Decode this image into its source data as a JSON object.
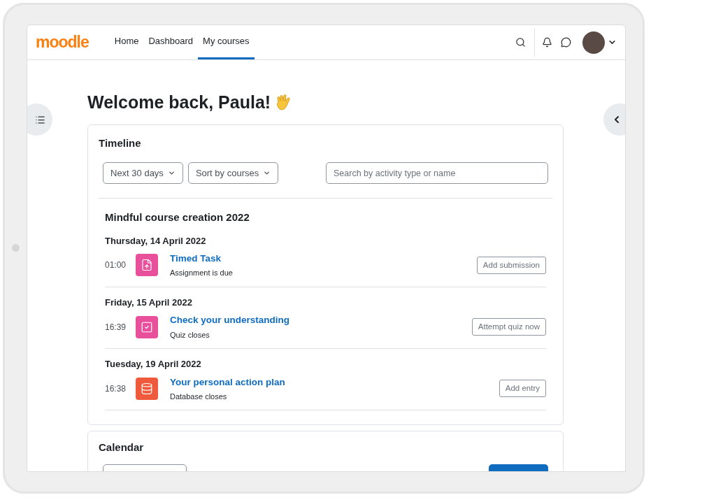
{
  "navbar": {
    "logo": "moodle",
    "links": [
      {
        "label": "Home",
        "selected": false
      },
      {
        "label": "Dashboard",
        "selected": false
      },
      {
        "label": "My courses",
        "selected": true
      }
    ]
  },
  "heading": "Welcome back, Paula!",
  "timeline": {
    "title": "Timeline",
    "filters": [
      "Next 30 days",
      "Sort by courses"
    ],
    "search": {
      "placeholder": "Search by activity type or name"
    },
    "course": "Mindful course creation 2022",
    "days": [
      {
        "date": "Thursday, 14 April 2022",
        "events": [
          {
            "time": "01:00",
            "kind": "assignment",
            "color": "#e8509b",
            "title": "Timed Task",
            "subtitle": "Assignment is due",
            "action": "Add submission"
          }
        ]
      },
      {
        "date": "Friday, 15 April 2022",
        "events": [
          {
            "time": "16:39",
            "kind": "quiz",
            "color": "#e8509b",
            "title": "Check your understanding",
            "subtitle": "Quiz closes",
            "action": "Attempt quiz now"
          }
        ]
      },
      {
        "date": "Tuesday, 19 April 2022",
        "events": [
          {
            "time": "16:38",
            "kind": "database",
            "color": "#f05a3c",
            "title": "Your personal action plan",
            "subtitle": "Database closes",
            "action": "Add entry"
          }
        ]
      }
    ]
  },
  "calendar": {
    "title": "Calendar"
  }
}
